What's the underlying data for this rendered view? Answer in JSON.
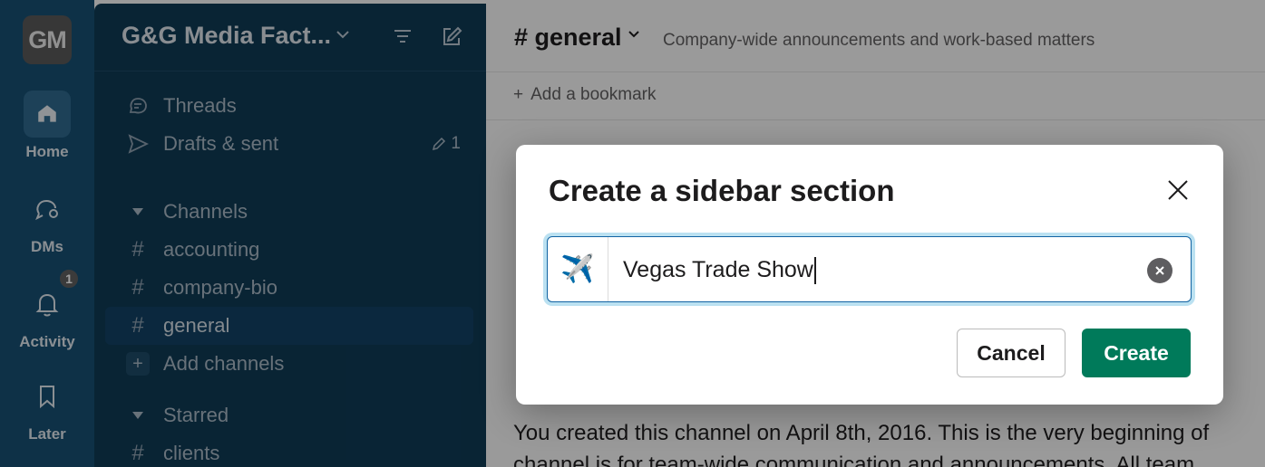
{
  "workspace": {
    "initials": "GM",
    "name": "G&G Media Fact...",
    "rail": [
      {
        "label": "Home",
        "icon": "home-icon",
        "active": true
      },
      {
        "label": "DMs",
        "icon": "dms-icon"
      },
      {
        "label": "Activity",
        "icon": "bell-icon",
        "badge": "1"
      },
      {
        "label": "Later",
        "icon": "bookmark-icon"
      }
    ]
  },
  "sidebar": {
    "threads": "Threads",
    "drafts": "Drafts & sent",
    "drafts_count": "1",
    "channels_header": "Channels",
    "channels": [
      "accounting",
      "company-bio",
      "general"
    ],
    "active_channel": "general",
    "add_channels": "Add channels",
    "starred_header": "Starred",
    "starred": [
      "clients"
    ]
  },
  "main": {
    "channel_name": "# general",
    "topic": "Company-wide announcements and work-based matters",
    "add_bookmark": "Add a bookmark",
    "intro_line1": "You created this channel on April 8th, 2016. This is the very beginning of",
    "intro_line2": "channel is for team-wide communication and announcements. All team"
  },
  "modal": {
    "title": "Create a sidebar section",
    "emoji": "✈️",
    "section_name": "Vegas Trade Show",
    "cancel_label": "Cancel",
    "create_label": "Create"
  },
  "colors": {
    "rail": "#184f73",
    "sidebar": "#0f3a55",
    "create_button": "#007a5a",
    "focus_ring": "#1264a3"
  }
}
